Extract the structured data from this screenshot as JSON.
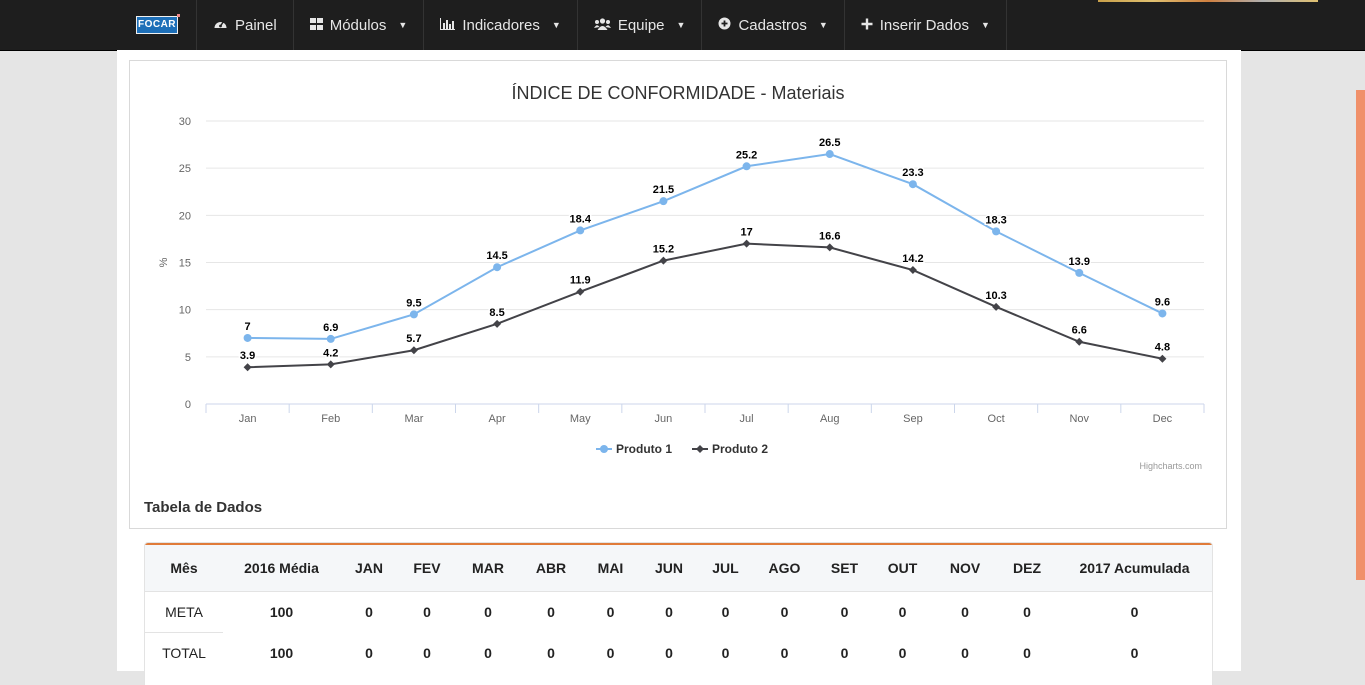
{
  "navbar": {
    "brand": "FOCAR",
    "items": [
      {
        "label": "Painel",
        "icon": "dashboard-icon",
        "dropdown": false
      },
      {
        "label": "Módulos",
        "icon": "grid-icon",
        "dropdown": true
      },
      {
        "label": "Indicadores",
        "icon": "bar-chart-icon",
        "dropdown": true
      },
      {
        "label": "Equipe",
        "icon": "users-icon",
        "dropdown": true
      },
      {
        "label": "Cadastros",
        "icon": "plus-circle-icon",
        "dropdown": true
      },
      {
        "label": "Inserir Dados",
        "icon": "plus-icon",
        "dropdown": true
      }
    ]
  },
  "chart_data": {
    "type": "line",
    "title": "ÍNDICE DE CONFORMIDADE - Materiais",
    "ylabel": "%",
    "xlabel": "",
    "categories": [
      "Jan",
      "Feb",
      "Mar",
      "Apr",
      "May",
      "Jun",
      "Jul",
      "Aug",
      "Sep",
      "Oct",
      "Nov",
      "Dec"
    ],
    "ylim": [
      0,
      30
    ],
    "yticks": [
      0,
      5,
      10,
      15,
      20,
      25,
      30
    ],
    "grid": true,
    "legend": "bottom-center",
    "series": [
      {
        "name": "Produto 1",
        "color": "#7cb5ec",
        "marker": "circle",
        "values": [
          7,
          6.9,
          9.5,
          14.5,
          18.4,
          21.5,
          25.2,
          26.5,
          23.3,
          18.3,
          13.9,
          9.6
        ]
      },
      {
        "name": "Produto 2",
        "color": "#434348",
        "marker": "diamond",
        "values": [
          3.9,
          4.2,
          5.7,
          8.5,
          11.9,
          15.2,
          17,
          16.6,
          14.2,
          10.3,
          6.6,
          4.8
        ]
      }
    ],
    "credits": "Highcharts.com"
  },
  "table": {
    "title": "Tabela de Dados",
    "headers": [
      "Mês",
      "2016 Média",
      "JAN",
      "FEV",
      "MAR",
      "ABR",
      "MAI",
      "JUN",
      "JUL",
      "AGO",
      "SET",
      "OUT",
      "NOV",
      "DEZ",
      "2017 Acumulada"
    ],
    "rows": [
      [
        "META",
        "100",
        "0",
        "0",
        "0",
        "0",
        "0",
        "0",
        "0",
        "0",
        "0",
        "0",
        "0",
        "0",
        "0"
      ],
      [
        "TOTAL",
        "100",
        "0",
        "0",
        "0",
        "0",
        "0",
        "0",
        "0",
        "0",
        "0",
        "0",
        "0",
        "0",
        "0"
      ]
    ]
  },
  "colors": {
    "accent": "#e07b39",
    "navbar": "#1e1e1e"
  }
}
